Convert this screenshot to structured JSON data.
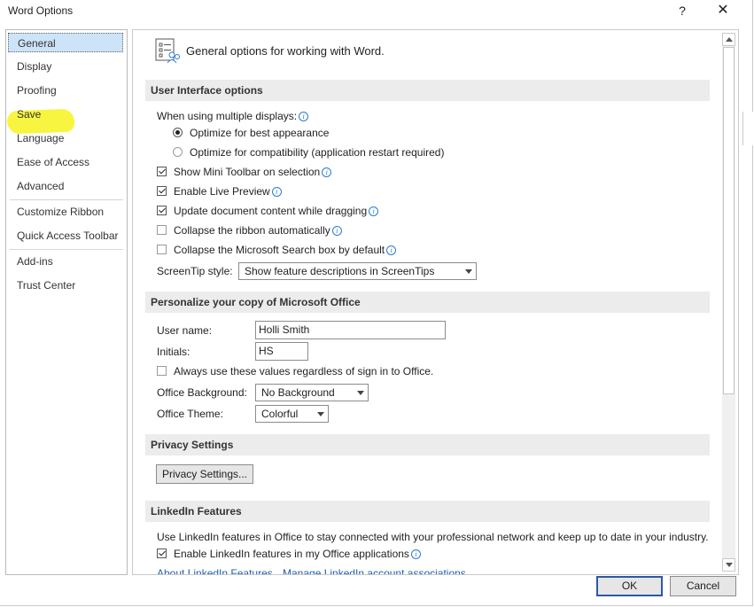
{
  "window": {
    "title": "Word Options",
    "help": "?",
    "close": "✕"
  },
  "nav": {
    "items": [
      {
        "label": "General"
      },
      {
        "label": "Display"
      },
      {
        "label": "Proofing"
      },
      {
        "label": "Save"
      },
      {
        "label": "Language"
      },
      {
        "label": "Ease of Access"
      },
      {
        "label": "Advanced"
      },
      {
        "label": "Customize Ribbon"
      },
      {
        "label": "Quick Access Toolbar"
      },
      {
        "label": "Add-ins"
      },
      {
        "label": "Trust Center"
      }
    ],
    "selected": "General",
    "highlight_color": "#f8f437"
  },
  "content": {
    "header": "General options for working with Word.",
    "ui_options": {
      "title": "User Interface options",
      "multiple_displays_label": "When using multiple displays:",
      "radio_best": "Optimize for best appearance",
      "radio_compat": "Optimize for compatibility (application restart required)",
      "mini_toolbar": "Show Mini Toolbar on selection",
      "live_preview": "Enable Live Preview",
      "update_dragging": "Update document content while dragging",
      "collapse_ribbon": "Collapse the ribbon automatically",
      "collapse_search": "Collapse the Microsoft Search box by default",
      "screentip_label": "ScreenTip style:",
      "screentip_value": "Show feature descriptions in ScreenTips"
    },
    "personalize": {
      "title": "Personalize your copy of Microsoft Office",
      "username_label": "User name:",
      "username_value": "Holli Smith",
      "initials_label": "Initials:",
      "initials_value": "HS",
      "always_use": "Always use these values regardless of sign in to Office.",
      "background_label": "Office Background:",
      "background_value": "No Background",
      "theme_label": "Office Theme:",
      "theme_value": "Colorful"
    },
    "privacy": {
      "title": "Privacy Settings",
      "button": "Privacy Settings..."
    },
    "linkedin": {
      "title": "LinkedIn Features",
      "description": "Use LinkedIn features in Office to stay connected with your professional network and keep up to date in your industry.",
      "enable": "Enable LinkedIn features in my Office applications",
      "about_link": "About LinkedIn Features",
      "manage_link": "Manage LinkedIn account associations"
    }
  },
  "footer": {
    "ok": "OK",
    "cancel": "Cancel"
  }
}
